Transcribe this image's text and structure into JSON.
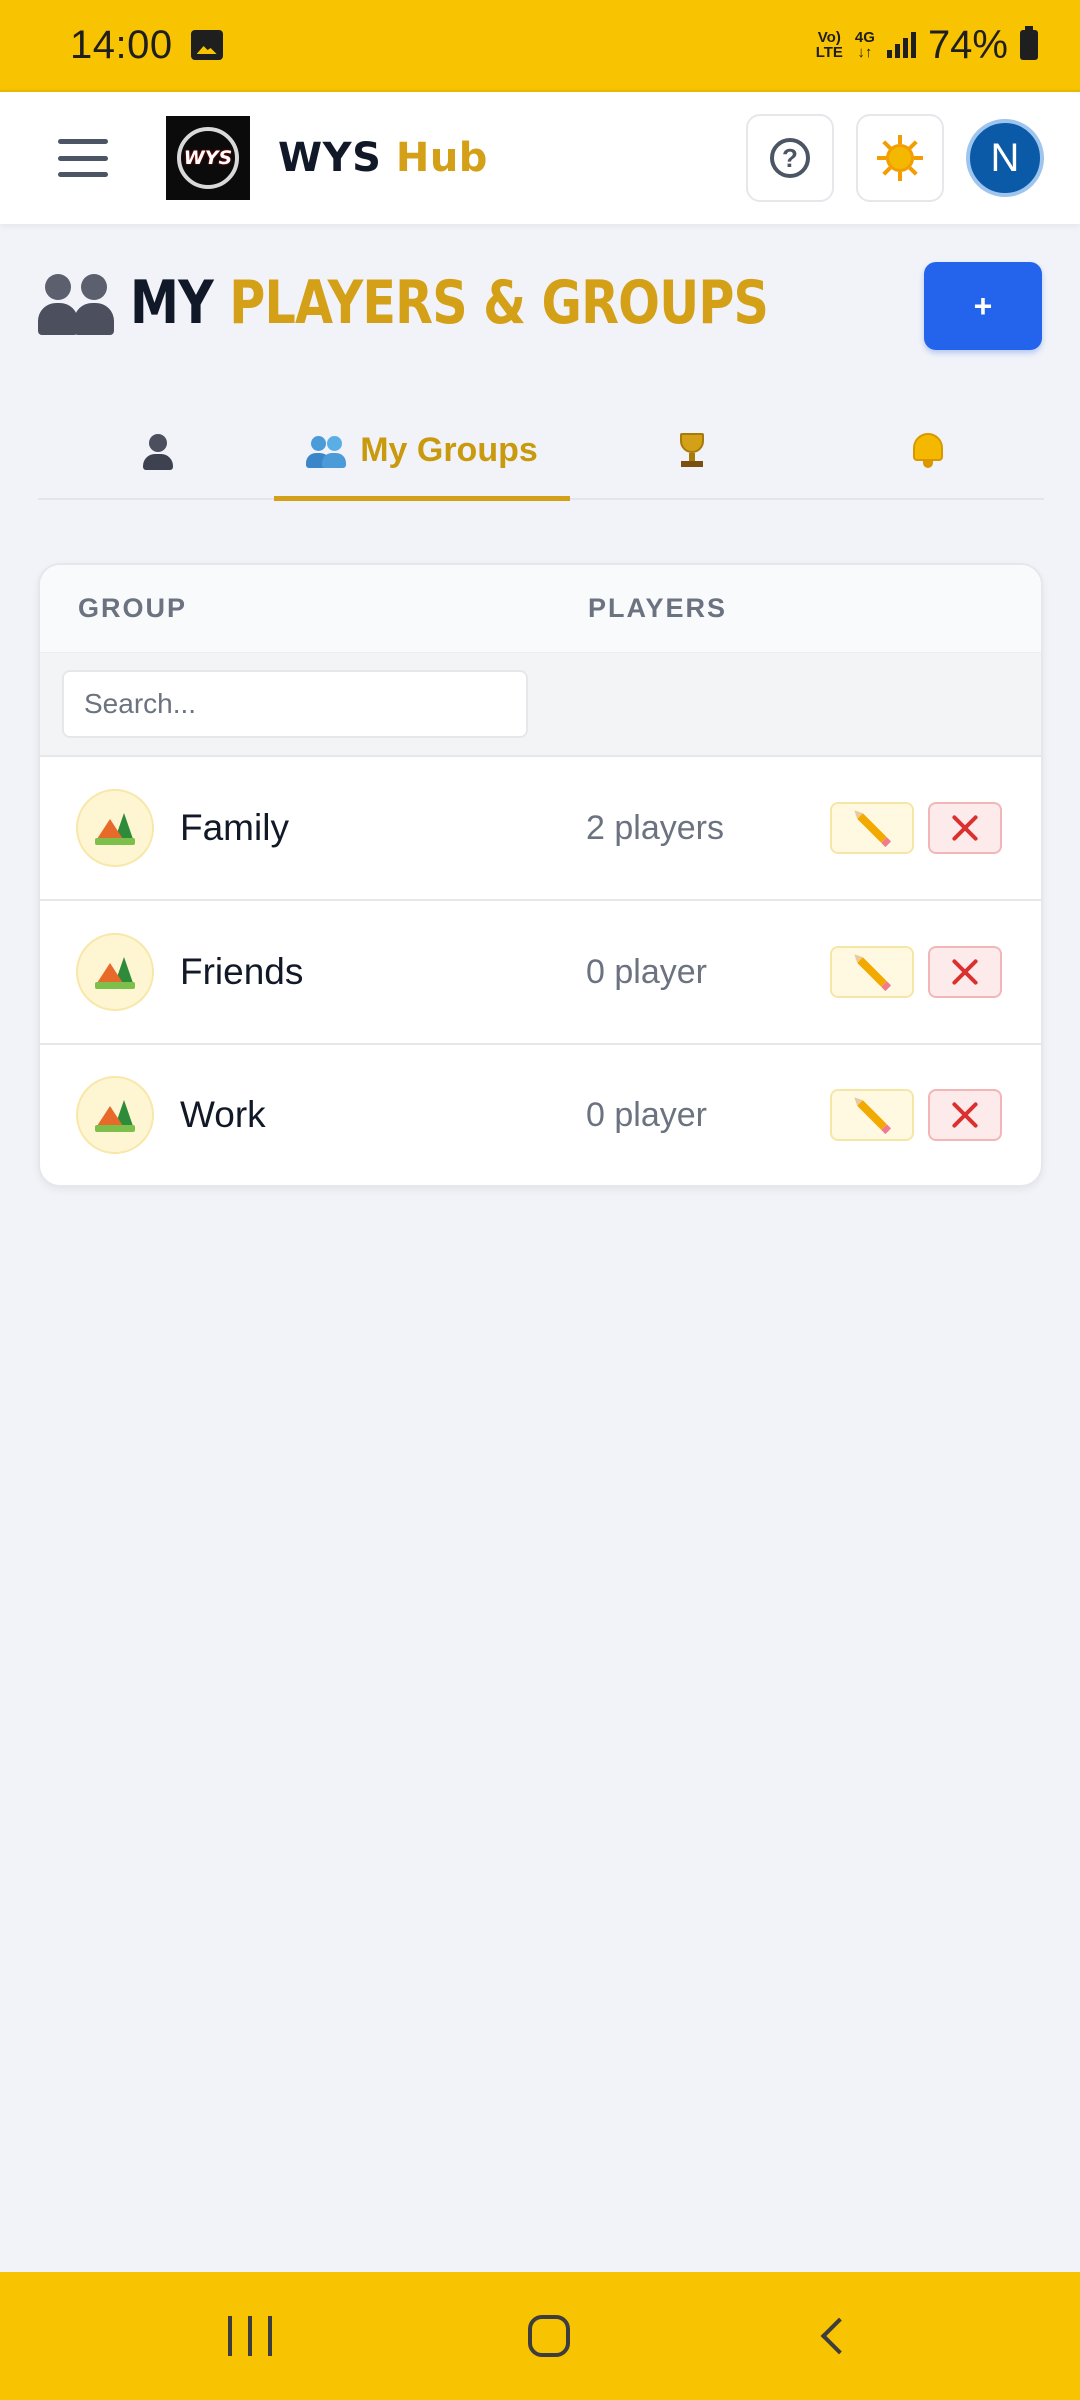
{
  "status_bar": {
    "time": "14:00",
    "network_top": "Vo)",
    "network_bottom": "LTE",
    "net_type": "4G",
    "battery": "74%"
  },
  "header": {
    "brand_part1": "WYS",
    "brand_part2": "Hub",
    "logo_text": "WYS",
    "avatar_initial": "N",
    "help_glyph": "?"
  },
  "page": {
    "title_part1": "MY",
    "title_part2": "PLAYERS & GROUPS",
    "add_button_label": "+"
  },
  "tabs": [
    {
      "label": "",
      "icon": "player-icon",
      "active": false
    },
    {
      "label": "My Groups",
      "icon": "groups-icon",
      "active": true
    },
    {
      "label": "",
      "icon": "trophy-icon",
      "active": false
    },
    {
      "label": "",
      "icon": "bell-icon",
      "active": false
    }
  ],
  "table": {
    "columns": [
      "GROUP",
      "PLAYERS"
    ],
    "search_placeholder": "Search...",
    "rows": [
      {
        "name": "Family",
        "players": "2 players",
        "icon": "camping-icon"
      },
      {
        "name": "Friends",
        "players": "0 player",
        "icon": "camping-icon"
      },
      {
        "name": "Work",
        "players": "0 player",
        "icon": "camping-icon"
      }
    ]
  },
  "colors": {
    "accent_yellow": "#f8c300",
    "brand_gold": "#d4a017",
    "primary_blue": "#2463eb",
    "avatar_blue": "#0b5aa8",
    "danger_red": "#d93030"
  }
}
